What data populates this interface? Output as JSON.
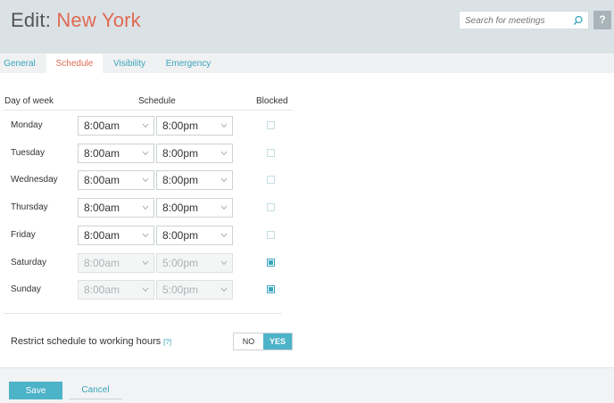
{
  "header": {
    "title_prefix": "Edit: ",
    "title_name": "New York",
    "search_placeholder": "Search for meetings",
    "help_label": "?"
  },
  "tabs": [
    {
      "label": "General",
      "active": false
    },
    {
      "label": "Schedule",
      "active": true
    },
    {
      "label": "Visibility",
      "active": false
    },
    {
      "label": "Emergency",
      "active": false
    }
  ],
  "table": {
    "headers": {
      "day": "Day of week",
      "schedule": "Schedule",
      "blocked": "Blocked"
    },
    "rows": [
      {
        "day": "Monday",
        "start": "8:00am",
        "end": "8:00pm",
        "blocked": false
      },
      {
        "day": "Tuesday",
        "start": "8:00am",
        "end": "8:00pm",
        "blocked": false
      },
      {
        "day": "Wednesday",
        "start": "8:00am",
        "end": "8:00pm",
        "blocked": false
      },
      {
        "day": "Thursday",
        "start": "8:00am",
        "end": "8:00pm",
        "blocked": false
      },
      {
        "day": "Friday",
        "start": "8:00am",
        "end": "8:00pm",
        "blocked": false
      },
      {
        "day": "Saturday",
        "start": "8:00am",
        "end": "5:00pm",
        "blocked": true
      },
      {
        "day": "Sunday",
        "start": "8:00am",
        "end": "5:00pm",
        "blocked": true
      }
    ]
  },
  "restrict": {
    "label": "Restrict schedule to working hours",
    "help": "[?]",
    "no_label": "NO",
    "yes_label": "YES",
    "value": "YES"
  },
  "footer": {
    "save_label": "Save",
    "cancel_label": "Cancel"
  },
  "colors": {
    "accent": "#e06a52",
    "primary": "#4db3c8",
    "link": "#3aa5bc",
    "header_bg": "#dbe2e6"
  },
  "icons": {
    "search": "search-icon",
    "dropdown": "chevron-down-icon"
  }
}
